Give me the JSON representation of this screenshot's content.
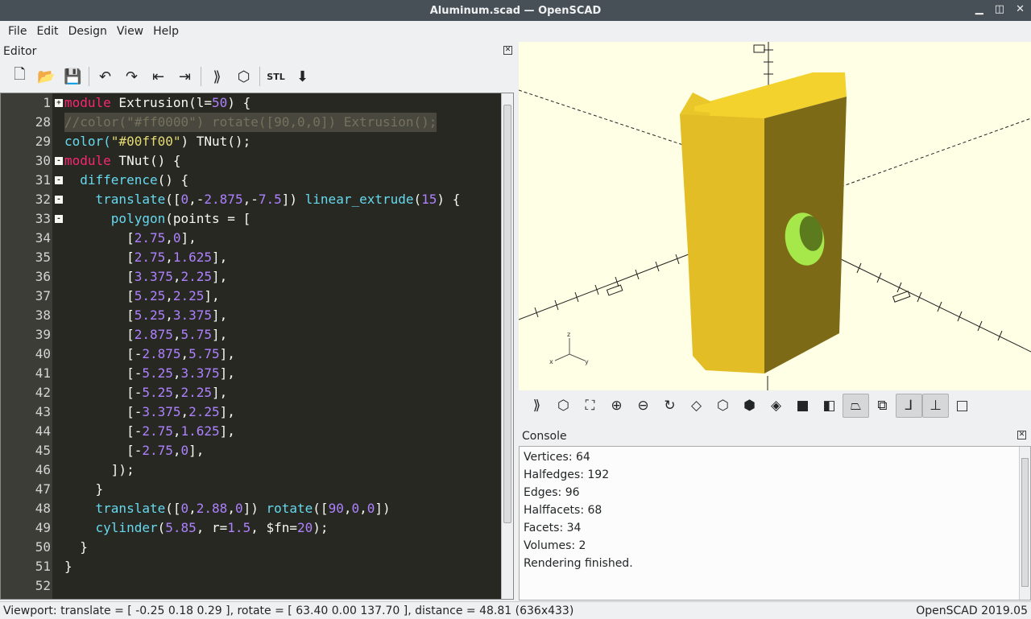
{
  "window": {
    "title": "Aluminum.scad — OpenSCAD"
  },
  "menu": [
    "File",
    "Edit",
    "Design",
    "View",
    "Help"
  ],
  "editor": {
    "title": "Editor",
    "lines": [
      {
        "n": "1",
        "fold": "+",
        "segs": [
          [
            "module",
            "#f92672"
          ],
          [
            " Extrusion(l=",
            "#f8f8f2"
          ],
          [
            "50",
            "#ae81ff"
          ],
          [
            ") {",
            "#f8f8f2"
          ]
        ]
      },
      {
        "n": "28",
        "fold": "",
        "cur": true,
        "segs": [
          [
            "//color(\"#ff0000\") rotate([90,0,0]) Extrusion();",
            "#75715e"
          ]
        ]
      },
      {
        "n": "29",
        "fold": "",
        "segs": [
          [
            "color(",
            "#66d9ef"
          ],
          [
            "\"#00ff00\"",
            "#e6db74"
          ],
          [
            ") TNut();",
            "#f8f8f2"
          ]
        ]
      },
      {
        "n": "30",
        "fold": "-",
        "segs": [
          [
            "module",
            "#f92672"
          ],
          [
            " TNut() {",
            "#f8f8f2"
          ]
        ]
      },
      {
        "n": "31",
        "fold": "-",
        "segs": [
          [
            "  difference",
            "#66d9ef"
          ],
          [
            "() {",
            "#f8f8f2"
          ]
        ]
      },
      {
        "n": "32",
        "fold": "-",
        "segs": [
          [
            "    translate",
            "#66d9ef"
          ],
          [
            "([",
            "#f8f8f2"
          ],
          [
            "0",
            "#ae81ff"
          ],
          [
            ",-",
            "#f8f8f2"
          ],
          [
            "2.875",
            "#ae81ff"
          ],
          [
            ",-",
            "#f8f8f2"
          ],
          [
            "7.5",
            "#ae81ff"
          ],
          [
            "]) ",
            "#f8f8f2"
          ],
          [
            "linear_extrude",
            "#66d9ef"
          ],
          [
            "(",
            "#f8f8f2"
          ],
          [
            "15",
            "#ae81ff"
          ],
          [
            ") {",
            "#f8f8f2"
          ]
        ]
      },
      {
        "n": "33",
        "fold": "-",
        "segs": [
          [
            "      polygon",
            "#66d9ef"
          ],
          [
            "(points = [",
            "#f8f8f2"
          ]
        ]
      },
      {
        "n": "34",
        "fold": "",
        "segs": [
          [
            "        [",
            "#f8f8f2"
          ],
          [
            "2.75",
            "#ae81ff"
          ],
          [
            ",",
            "#f8f8f2"
          ],
          [
            "0",
            "#ae81ff"
          ],
          [
            "],",
            "#f8f8f2"
          ]
        ]
      },
      {
        "n": "35",
        "fold": "",
        "segs": [
          [
            "        [",
            "#f8f8f2"
          ],
          [
            "2.75",
            "#ae81ff"
          ],
          [
            ",",
            "#f8f8f2"
          ],
          [
            "1.625",
            "#ae81ff"
          ],
          [
            "],",
            "#f8f8f2"
          ]
        ]
      },
      {
        "n": "36",
        "fold": "",
        "segs": [
          [
            "        [",
            "#f8f8f2"
          ],
          [
            "3.375",
            "#ae81ff"
          ],
          [
            ",",
            "#f8f8f2"
          ],
          [
            "2.25",
            "#ae81ff"
          ],
          [
            "],",
            "#f8f8f2"
          ]
        ]
      },
      {
        "n": "37",
        "fold": "",
        "segs": [
          [
            "        [",
            "#f8f8f2"
          ],
          [
            "5.25",
            "#ae81ff"
          ],
          [
            ",",
            "#f8f8f2"
          ],
          [
            "2.25",
            "#ae81ff"
          ],
          [
            "],",
            "#f8f8f2"
          ]
        ]
      },
      {
        "n": "38",
        "fold": "",
        "segs": [
          [
            "        [",
            "#f8f8f2"
          ],
          [
            "5.25",
            "#ae81ff"
          ],
          [
            ",",
            "#f8f8f2"
          ],
          [
            "3.375",
            "#ae81ff"
          ],
          [
            "],",
            "#f8f8f2"
          ]
        ]
      },
      {
        "n": "39",
        "fold": "",
        "segs": [
          [
            "        [",
            "#f8f8f2"
          ],
          [
            "2.875",
            "#ae81ff"
          ],
          [
            ",",
            "#f8f8f2"
          ],
          [
            "5.75",
            "#ae81ff"
          ],
          [
            "],",
            "#f8f8f2"
          ]
        ]
      },
      {
        "n": "40",
        "fold": "",
        "segs": [
          [
            "        [-",
            "#f8f8f2"
          ],
          [
            "2.875",
            "#ae81ff"
          ],
          [
            ",",
            "#f8f8f2"
          ],
          [
            "5.75",
            "#ae81ff"
          ],
          [
            "],",
            "#f8f8f2"
          ]
        ]
      },
      {
        "n": "41",
        "fold": "",
        "segs": [
          [
            "        [-",
            "#f8f8f2"
          ],
          [
            "5.25",
            "#ae81ff"
          ],
          [
            ",",
            "#f8f8f2"
          ],
          [
            "3.375",
            "#ae81ff"
          ],
          [
            "],",
            "#f8f8f2"
          ]
        ]
      },
      {
        "n": "42",
        "fold": "",
        "segs": [
          [
            "        [-",
            "#f8f8f2"
          ],
          [
            "5.25",
            "#ae81ff"
          ],
          [
            ",",
            "#f8f8f2"
          ],
          [
            "2.25",
            "#ae81ff"
          ],
          [
            "],",
            "#f8f8f2"
          ]
        ]
      },
      {
        "n": "43",
        "fold": "",
        "segs": [
          [
            "        [-",
            "#f8f8f2"
          ],
          [
            "3.375",
            "#ae81ff"
          ],
          [
            ",",
            "#f8f8f2"
          ],
          [
            "2.25",
            "#ae81ff"
          ],
          [
            "],",
            "#f8f8f2"
          ]
        ]
      },
      {
        "n": "44",
        "fold": "",
        "segs": [
          [
            "        [-",
            "#f8f8f2"
          ],
          [
            "2.75",
            "#ae81ff"
          ],
          [
            ",",
            "#f8f8f2"
          ],
          [
            "1.625",
            "#ae81ff"
          ],
          [
            "],",
            "#f8f8f2"
          ]
        ]
      },
      {
        "n": "45",
        "fold": "",
        "segs": [
          [
            "        [-",
            "#f8f8f2"
          ],
          [
            "2.75",
            "#ae81ff"
          ],
          [
            ",",
            "#f8f8f2"
          ],
          [
            "0",
            "#ae81ff"
          ],
          [
            "],",
            "#f8f8f2"
          ]
        ]
      },
      {
        "n": "46",
        "fold": "",
        "segs": [
          [
            "      ]);",
            "#f8f8f2"
          ]
        ]
      },
      {
        "n": "47",
        "fold": "",
        "segs": [
          [
            "    }",
            "#f8f8f2"
          ]
        ]
      },
      {
        "n": "48",
        "fold": "",
        "segs": [
          [
            "    translate",
            "#66d9ef"
          ],
          [
            "([",
            "#f8f8f2"
          ],
          [
            "0",
            "#ae81ff"
          ],
          [
            ",",
            "#f8f8f2"
          ],
          [
            "2.88",
            "#ae81ff"
          ],
          [
            ",",
            "#f8f8f2"
          ],
          [
            "0",
            "#ae81ff"
          ],
          [
            "]) ",
            "#f8f8f2"
          ],
          [
            "rotate",
            "#66d9ef"
          ],
          [
            "([",
            "#f8f8f2"
          ],
          [
            "90",
            "#ae81ff"
          ],
          [
            ",",
            "#f8f8f2"
          ],
          [
            "0",
            "#ae81ff"
          ],
          [
            ",",
            "#f8f8f2"
          ],
          [
            "0",
            "#ae81ff"
          ],
          [
            "])",
            "#f8f8f2"
          ]
        ]
      },
      {
        "n": "49",
        "fold": "",
        "segs": [
          [
            "    cylinder",
            "#66d9ef"
          ],
          [
            "(",
            "#f8f8f2"
          ],
          [
            "5.85",
            "#ae81ff"
          ],
          [
            ", r=",
            "#f8f8f2"
          ],
          [
            "1.5",
            "#ae81ff"
          ],
          [
            ", $fn=",
            "#f8f8f2"
          ],
          [
            "20",
            "#ae81ff"
          ],
          [
            ");",
            "#f8f8f2"
          ]
        ]
      },
      {
        "n": "50",
        "fold": "",
        "segs": [
          [
            "  }",
            "#f8f8f2"
          ]
        ]
      },
      {
        "n": "51",
        "fold": "",
        "segs": [
          [
            "}",
            "#f8f8f2"
          ]
        ]
      },
      {
        "n": "52",
        "fold": "",
        "segs": []
      }
    ]
  },
  "editor_toolbar": [
    {
      "name": "new-file-icon",
      "glyph": "🗋"
    },
    {
      "name": "open-file-icon",
      "glyph": "📂"
    },
    {
      "name": "save-file-icon",
      "glyph": "💾"
    },
    {
      "sep": true
    },
    {
      "name": "undo-icon",
      "glyph": "↶"
    },
    {
      "name": "redo-icon",
      "glyph": "↷"
    },
    {
      "name": "unindent-icon",
      "glyph": "⇤"
    },
    {
      "name": "indent-icon",
      "glyph": "⇥"
    },
    {
      "sep": true
    },
    {
      "name": "preview-icon",
      "glyph": "⟫"
    },
    {
      "name": "render-icon",
      "glyph": "⬡"
    },
    {
      "sep": true
    },
    {
      "name": "export-stl-icon",
      "glyph": "STL"
    },
    {
      "name": "send-to-printer-icon",
      "glyph": "⬇"
    }
  ],
  "view_toolbar": [
    {
      "name": "preview-icon",
      "glyph": "⟫"
    },
    {
      "name": "render-icon",
      "glyph": "⬡"
    },
    {
      "name": "view-all-icon",
      "glyph": "⛶"
    },
    {
      "name": "zoom-in-icon",
      "glyph": "⊕"
    },
    {
      "name": "zoom-out-icon",
      "glyph": "⊖"
    },
    {
      "name": "reset-view-icon",
      "glyph": "↻"
    },
    {
      "name": "view-right-icon",
      "glyph": "◇"
    },
    {
      "name": "view-top-icon",
      "glyph": "⬡"
    },
    {
      "name": "view-bottom-icon",
      "glyph": "⬢"
    },
    {
      "name": "view-left-icon",
      "glyph": "◈"
    },
    {
      "name": "view-front-icon",
      "glyph": "■"
    },
    {
      "name": "view-back-icon",
      "glyph": "◧"
    },
    {
      "name": "perspective-icon",
      "glyph": "⏢",
      "on": true
    },
    {
      "name": "orthogonal-icon",
      "glyph": "⧉"
    },
    {
      "name": "show-axes-icon",
      "glyph": "⅃",
      "on": true
    },
    {
      "name": "show-scale-markers-icon",
      "glyph": "⊥",
      "on": true
    },
    {
      "name": "show-edges-icon",
      "glyph": "□"
    }
  ],
  "console": {
    "title": "Console",
    "lines": [
      "Vertices: 64",
      "Halfedges: 192",
      "Edges: 96",
      "Halffacets: 68",
      "Facets: 34",
      "Volumes: 2",
      "Rendering finished."
    ]
  },
  "status": {
    "viewport": "Viewport: translate = [ -0.25 0.18 0.29 ], rotate = [ 63.40 0.00 137.70 ], distance = 48.81 (636x433)",
    "version": "OpenSCAD 2019.05"
  },
  "model_colors": {
    "top": "#f3d22e",
    "left": "#e2bd26",
    "right": "#7d6a16",
    "hole": "#a6e84a",
    "background": "#ffffe5"
  }
}
